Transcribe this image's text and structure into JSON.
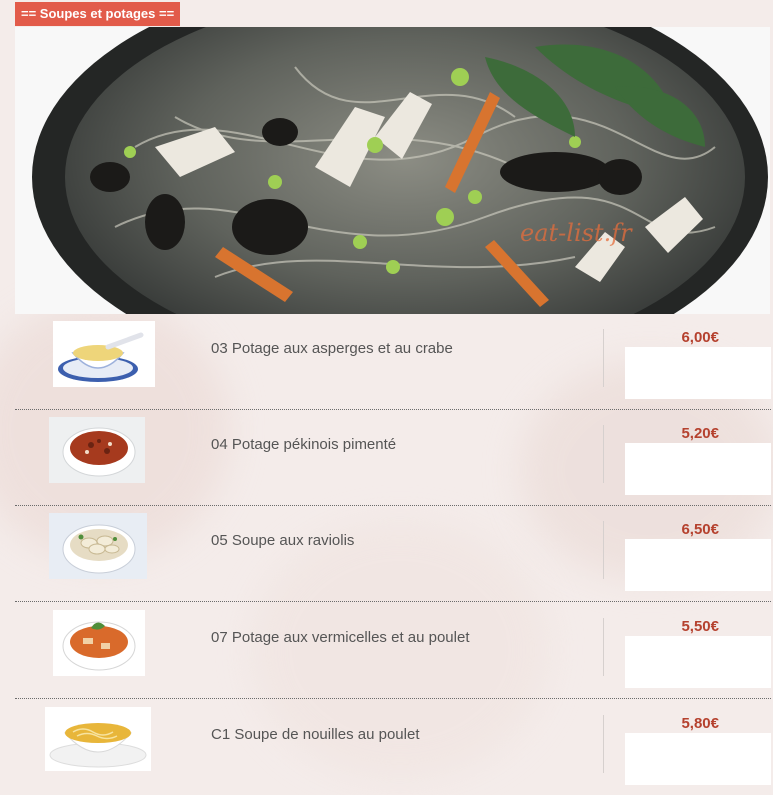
{
  "section_title": "== Soupes et potages ==",
  "watermark": "eat-list.fr",
  "items": [
    {
      "name": "03 Potage aux asperges et au crabe",
      "price": "6,00€",
      "thumb_icon": "corn-crab-soup-bowl-icon"
    },
    {
      "name": "04 Potage pékinois pimenté",
      "price": "5,20€",
      "thumb_icon": "spicy-soup-bowl-icon"
    },
    {
      "name": "05 Soupe aux raviolis",
      "price": "6,50€",
      "thumb_icon": "ravioli-soup-bowl-icon"
    },
    {
      "name": "07 Potage aux vermicelles et au poulet",
      "price": "5,50€",
      "thumb_icon": "vermicelli-chicken-soup-bowl-icon"
    },
    {
      "name": "C1 Soupe de nouilles au poulet",
      "price": "5,80€",
      "thumb_icon": "noodle-chicken-soup-bowl-icon"
    }
  ],
  "colors": {
    "tag_bg": "#e25b4a",
    "price": "#b5412e",
    "text": "#555555"
  }
}
